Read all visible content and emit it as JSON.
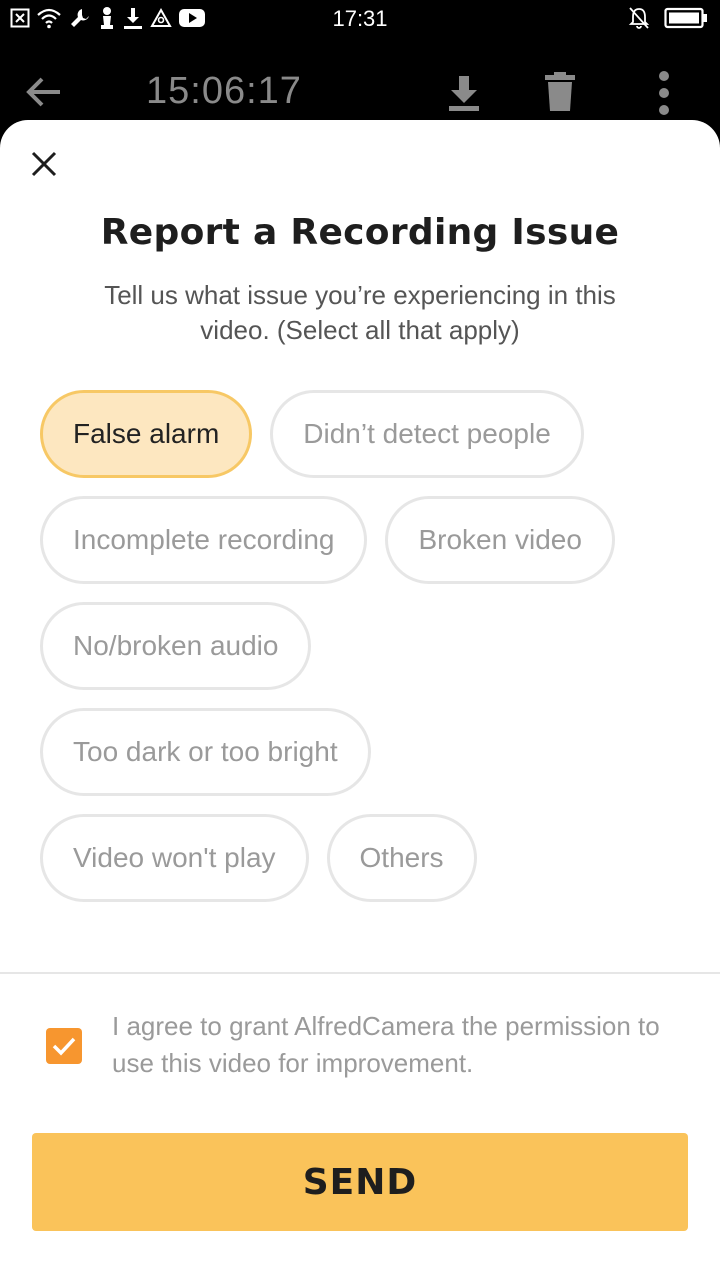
{
  "status_bar": {
    "time": "17:31",
    "left_icons": [
      "close-box-icon",
      "wifi-icon",
      "wrench-icon",
      "chess-icon",
      "download-icon",
      "triangle-icon",
      "youtube-icon"
    ],
    "right_icons": [
      "bell-off-icon",
      "battery-icon"
    ]
  },
  "app_bar": {
    "title": "15:06:17",
    "icons": [
      "back-arrow-icon",
      "download-icon",
      "trash-icon",
      "more-vertical-icon"
    ]
  },
  "sheet": {
    "title": "Report a Recording Issue",
    "subtitle": "Tell us what issue you’re experiencing in this video. (Select all that apply)",
    "chips": [
      {
        "label": "False alarm",
        "selected": true
      },
      {
        "label": "Didn’t detect people",
        "selected": false
      },
      {
        "label": "Incomplete recording",
        "selected": false
      },
      {
        "label": "Broken video",
        "selected": false
      },
      {
        "label": "No/broken audio",
        "selected": false
      },
      {
        "label": "Too dark or too bright",
        "selected": false
      },
      {
        "label": "Video won't play",
        "selected": false
      },
      {
        "label": "Others",
        "selected": false
      }
    ],
    "consent": {
      "checked": true,
      "text": "I agree to grant AlfredCamera the permission to use this video for improvement."
    },
    "send_label": "SEND"
  },
  "colors": {
    "selected_chip_bg": "#fde7c0",
    "selected_chip_border": "#f7c865",
    "checkbox": "#f7962f",
    "send_button": "#fac35a"
  }
}
